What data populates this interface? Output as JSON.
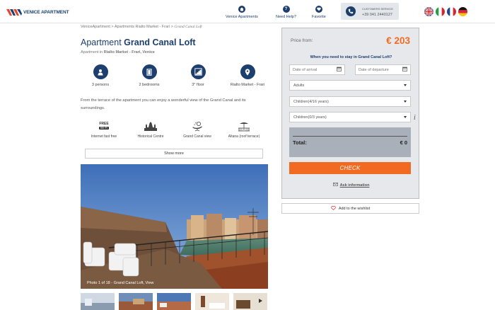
{
  "header": {
    "logo_text": "VENICE APARTMENT",
    "nav": [
      {
        "label": "Venice Apartments",
        "icon": "home-icon"
      },
      {
        "label": "Need Help?",
        "icon": "question-icon"
      },
      {
        "label": "Favorite",
        "icon": "heart-icon"
      }
    ],
    "service": {
      "title": "CUSTOMERS SERVICE",
      "number": "+39 041 2440127",
      "icon": "phone-icon"
    },
    "flags": [
      "uk-flag-icon",
      "italy-flag-icon",
      "france-flag-icon",
      "germany-flag-icon"
    ]
  },
  "breadcrumb": {
    "items": [
      "VeniceApartment",
      "Apartments Rialto Market - Frari"
    ],
    "separator": ">",
    "current": "Grand Canal Loft"
  },
  "apartment": {
    "title_prefix": "Apartment",
    "title_name": "Grand Canal Loft",
    "subtitle_prefix": "Apartment in",
    "location": "Rialto Market - Frari, Venice"
  },
  "features": [
    {
      "label": "3 persons",
      "icon": "person-icon"
    },
    {
      "label": "2 bedrooms",
      "icon": "door-icon"
    },
    {
      "label": "3° floor",
      "icon": "stairs-icon"
    },
    {
      "label": "Rialto Market - Frari",
      "icon": "map-pin-icon"
    }
  ],
  "description": "From the terrace of the apartment you can enjoy a wonderful view of the Grand Canal and its surroundings.",
  "amenities": [
    {
      "label": "Internet fast free",
      "icon": "free-wifi-icon",
      "badge_top": "FREE",
      "badge_bottom": "Wi-Fi"
    },
    {
      "label": "Historical Centre",
      "icon": "historical-centre-icon"
    },
    {
      "label": "Grand Canal view",
      "icon": "canal-view-icon"
    },
    {
      "label": "Altana (roof terrace)",
      "icon": "roof-terrace-icon"
    }
  ],
  "show_more_label": "Show more",
  "photo": {
    "caption": "Photo 1 of 18 - Grand Canal Loft, View"
  },
  "thumbnails_count": 5,
  "booking": {
    "price_label": "Price from:",
    "price_value": "€ 203",
    "question": "When you need to stay in Grand Canal Loft?",
    "arrival_placeholder": "Date of arrival",
    "departure_placeholder": "Date of departure",
    "adults_label": "Adults",
    "children_4_16_label": "Children(4/16 years)",
    "children_0_3_label": "Children(0/3 years)",
    "info_glyph": "i",
    "total_label": "Total:",
    "total_value": "€ 0",
    "check_label": "CHECK",
    "ask_label": "Ask information"
  },
  "wishlist_label": "Add to the wishlist",
  "colors": {
    "brand_blue": "#1c3f6e",
    "accent_orange": "#f26a21",
    "panel_gray": "#e6e8eb"
  }
}
